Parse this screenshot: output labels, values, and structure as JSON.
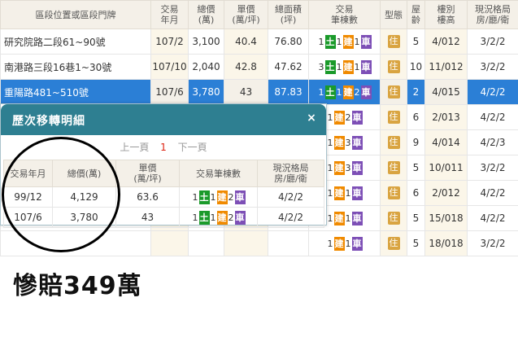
{
  "main_table": {
    "headers": [
      "區段位置或區段門牌",
      "交易\n年月",
      "總價\n(萬)",
      "單價\n(萬/坪)",
      "總面積\n(坪)",
      "交易\n筆棟數",
      "型態",
      "屋\n齡",
      "樓別\n樓高",
      "現況格局\n房/廳/衛"
    ],
    "rows": [
      {
        "addr": "研究院路二段61~90號",
        "date": "107/2",
        "total": "3,100",
        "unit": "40.4",
        "area": "76.80",
        "tx": [
          "1",
          "1",
          "1"
        ],
        "type": "住",
        "age": "5",
        "floor": "4/012",
        "layout": "3/2/2"
      },
      {
        "addr": "南港路三段16巷1~30號",
        "date": "107/10",
        "total": "2,040",
        "unit": "42.8",
        "area": "47.62",
        "tx": [
          "3",
          "1",
          "1"
        ],
        "type": "住",
        "age": "10",
        "floor": "11/012",
        "layout": "3/2/2"
      },
      {
        "addr": "重陽路481~510號",
        "date": "107/6",
        "total": "3,780",
        "unit": "43",
        "area": "87.83",
        "tx": [
          "1",
          "1",
          "2"
        ],
        "type": "住",
        "age": "2",
        "floor": "4/015",
        "layout": "4/2/2"
      },
      {
        "addr": "",
        "date": "",
        "total": "",
        "unit": "",
        "area": "",
        "tx": [
          "",
          "1",
          "2"
        ],
        "type": "住",
        "age": "6",
        "floor": "2/013",
        "layout": "4/2/2"
      },
      {
        "addr": "",
        "date": "",
        "total": "",
        "unit": "",
        "area": "",
        "tx": [
          "",
          "1",
          "3"
        ],
        "type": "住",
        "age": "9",
        "floor": "4/014",
        "layout": "4/2/3"
      },
      {
        "addr": "",
        "date": "",
        "total": "",
        "unit": "",
        "area": "",
        "tx": [
          "",
          "1",
          "3"
        ],
        "type": "住",
        "age": "5",
        "floor": "10/011",
        "layout": "3/2/2"
      },
      {
        "addr": "",
        "date": "",
        "total": "",
        "unit": "",
        "area": "",
        "tx": [
          "",
          "1",
          "1"
        ],
        "type": "住",
        "age": "6",
        "floor": "2/012",
        "layout": "4/2/2"
      },
      {
        "addr": "",
        "date": "",
        "total": "",
        "unit": "",
        "area": "",
        "tx": [
          "",
          "1",
          "1"
        ],
        "type": "住",
        "age": "5",
        "floor": "15/018",
        "layout": "4/2/2"
      },
      {
        "addr": "",
        "date": "",
        "total": "",
        "unit": "",
        "area": "",
        "tx": [
          "",
          "1",
          "1"
        ],
        "type": "住",
        "age": "5",
        "floor": "18/018",
        "layout": "3/2/2"
      }
    ]
  },
  "chips": {
    "land": "土",
    "building": "建",
    "car": "車"
  },
  "popup": {
    "title": "歷次移轉明細",
    "close_icon": "×",
    "pager": {
      "prev": "上一頁",
      "current": "1",
      "next": "下一頁"
    },
    "headers": [
      "交易年月",
      "總價(萬)",
      "單價\n(萬/坪)",
      "交易筆棟數",
      "現況格局\n房/廳/衛"
    ],
    "rows": [
      {
        "date": "99/12",
        "total": "4,129",
        "unit": "63.6",
        "tx": [
          "1",
          "1",
          "2"
        ],
        "layout": "4/2/2"
      },
      {
        "date": "107/6",
        "total": "3,780",
        "unit": "43",
        "tx": [
          "1",
          "1",
          "2"
        ],
        "layout": "4/2/2"
      }
    ]
  },
  "caption": "慘賠349萬"
}
